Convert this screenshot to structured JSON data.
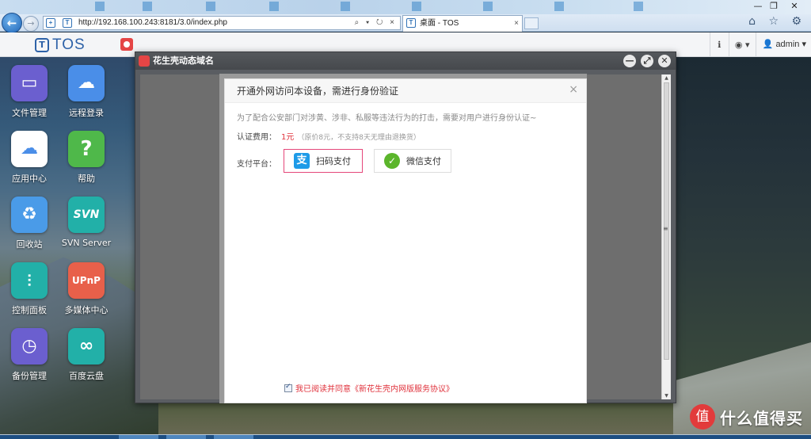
{
  "browser": {
    "url": "http://192.168.100.243:8181/3.0/index.php",
    "tab_title": "桌面 - TOS",
    "tab_close": "×",
    "back_glyph": "←",
    "forward_glyph": "→",
    "url_icons": "⌕ ▾ ↻ ×",
    "window_controls": [
      "—",
      "❐",
      "✕"
    ],
    "toolbar_icons": [
      "home-icon",
      "star-icon",
      "gear-icon"
    ],
    "toolbar_glyphs": "⌂ ☆ ⚙"
  },
  "tos_bar": {
    "logo_text": "TOS",
    "logo_mark": "T",
    "info_glyph": "ℹ",
    "globe_glyph": "◉ ▾",
    "user_label": "admin",
    "user_glyph": "▾"
  },
  "desktop": {
    "icons": [
      {
        "label": "文件管理",
        "icon": "monitor-icon",
        "color": "#6b5fcf"
      },
      {
        "label": "远程登录",
        "icon": "cloud-icon",
        "color": "#4a8ee8"
      },
      {
        "label": "应用中心",
        "icon": "bag-icon",
        "color": "#ffffff"
      },
      {
        "label": "帮助",
        "icon": "help-icon",
        "color": "#4fb84a"
      },
      {
        "label": "回收站",
        "icon": "recycle-icon",
        "color": "#4a9be8"
      },
      {
        "label": "SVN Server",
        "icon": "svn-icon",
        "color": "#22b0a8"
      },
      {
        "label": "控制面板",
        "icon": "sliders-icon",
        "color": "#22b0a8"
      },
      {
        "label": "多媒体中心",
        "icon": "upnp-icon",
        "color": "#e8604a"
      },
      {
        "label": "备份管理",
        "icon": "clock-icon",
        "color": "#6b5fcf"
      },
      {
        "label": "百度云盘",
        "icon": "baidu-icon",
        "color": "#22b0a8"
      }
    ],
    "brand_text": "什么值得买",
    "brand_logo": "值"
  },
  "app_window": {
    "title": "花生壳动态域名",
    "controls": [
      "—",
      "⤢",
      "✕"
    ]
  },
  "dialog": {
    "title": "开通外网访问本设备，需进行身份验证",
    "close": "×",
    "description": "为了配合公安部门对涉黄、涉非、私服等违法行为的打击，需要对用户进行身份认证~",
    "fee_label": "认证费用：",
    "fee_price": "1元",
    "fee_note": "（原价8元，不支持8天无理由退换货）",
    "pay_label": "支付平台：",
    "pay_options": [
      {
        "label": "扫码支付",
        "icon": "alipay-icon",
        "glyph": "支",
        "selected": true
      },
      {
        "label": "微信支付",
        "icon": "wechat-icon",
        "glyph": "✓",
        "selected": false
      }
    ],
    "agreement": "我已阅读并同意《新花生壳内网版服务协议》",
    "agreement_checked": true
  },
  "colors": {
    "accent": "#2e62a8",
    "selected_border": "#e5477a",
    "price": "#e0323c"
  }
}
